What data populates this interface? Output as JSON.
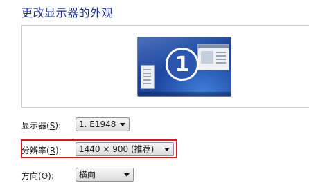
{
  "header": {
    "title": "更改显示器的外观"
  },
  "preview": {
    "monitor_number": "1",
    "icons": [
      "display-monitor-icon"
    ]
  },
  "fields": {
    "display": {
      "label_prefix": "显示器(",
      "label_key": "S",
      "label_suffix": "):",
      "value": "1. E1948"
    },
    "resolution": {
      "label_prefix": "分辨率(",
      "label_key": "R",
      "label_suffix": "):",
      "value": "1440 × 900 (推荐)"
    },
    "orientation": {
      "label_prefix": "方向(",
      "label_key": "O",
      "label_suffix": "):",
      "value": "横向"
    }
  },
  "colors": {
    "title": "#1e3287",
    "highlight_border": "#cc1e1e",
    "monitor_blue": "#2450a8"
  }
}
